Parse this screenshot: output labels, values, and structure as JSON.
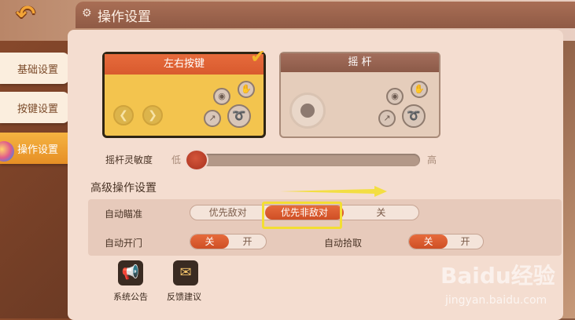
{
  "window": {
    "title": "操作设置"
  },
  "sidebar": {
    "items": [
      {
        "label": "基础设置"
      },
      {
        "label": "按键设置"
      },
      {
        "label": "操作设置"
      }
    ]
  },
  "modes": {
    "card_a": {
      "label": "左右按键"
    },
    "card_b": {
      "label": "摇 杆"
    }
  },
  "sensitivity": {
    "label": "摇杆灵敏度",
    "low": "低",
    "high": "高",
    "level": 0.05
  },
  "advanced": {
    "title": "高级操作设置",
    "auto_aim": {
      "label": "自动瞄准",
      "options": [
        "优先敌对",
        "优先非敌对",
        "关"
      ],
      "selected": "优先非敌对"
    },
    "auto_door": {
      "label": "自动开门",
      "options": [
        "关",
        "开"
      ],
      "selected": "关"
    },
    "auto_pickup": {
      "label": "自动拾取",
      "options": [
        "关",
        "开"
      ],
      "selected": "关"
    }
  },
  "bottom": {
    "announcement": "系统公告",
    "feedback": "反馈建议"
  },
  "watermark": {
    "brand": "Baidu经验",
    "url": "jingyan.baidu.com"
  },
  "colors": {
    "accent": "#e66b3c",
    "highlight": "#f3de33",
    "selected_card": "#f3c44e"
  }
}
